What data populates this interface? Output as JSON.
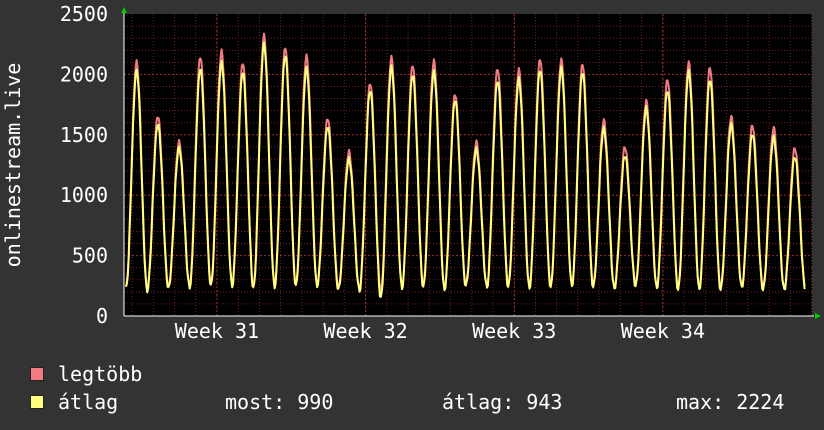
{
  "chart_data": {
    "type": "line",
    "ylabel": "onlinestream.live",
    "ylim": [
      0,
      2500
    ],
    "yticks": [
      "0",
      "500",
      "1000",
      "1500",
      "2000",
      "2500"
    ],
    "x_categories": [
      "Week 31",
      "Week 32",
      "Week 33",
      "Week 34"
    ],
    "grid": true,
    "colors": {
      "background": "#333333",
      "plot": "#000000",
      "grid": "#6e1f1f",
      "axis": "#ffffff",
      "arrow": "#00cc00"
    },
    "series": [
      {
        "name": "legtöbb",
        "color": "#f07c82",
        "daily_peaks": [
          2100,
          1660,
          1440,
          2150,
          2190,
          2100,
          2320,
          2230,
          2150,
          1640,
          1360,
          1930,
          2140,
          2080,
          2110,
          1840,
          1440,
          2050,
          2040,
          2130,
          2120,
          2090,
          1620,
          1400,
          1780,
          1960,
          2100,
          2060,
          1650,
          1580,
          1560,
          1390
        ],
        "daily_troughs": [
          240,
          220,
          240,
          250,
          260,
          260,
          240,
          250,
          260,
          260,
          230,
          220,
          200,
          240,
          250,
          230,
          260,
          250,
          250,
          240,
          250,
          260,
          250,
          240,
          260,
          240,
          230,
          230,
          230,
          250,
          230,
          230
        ]
      },
      {
        "name": "átlag",
        "color": "#ffff80",
        "daily_peaks": [
          2030,
          1590,
          1390,
          2050,
          2100,
          2020,
          2250,
          2160,
          2050,
          1570,
          1300,
          1870,
          2060,
          2000,
          2020,
          1790,
          1380,
          1950,
          1960,
          2040,
          2050,
          2020,
          1550,
          1330,
          1720,
          1870,
          2020,
          1960,
          1580,
          1510,
          1480,
          1320
        ],
        "daily_troughs": [
          230,
          210,
          230,
          240,
          250,
          250,
          230,
          240,
          250,
          250,
          220,
          210,
          150,
          230,
          240,
          220,
          250,
          240,
          240,
          230,
          240,
          250,
          240,
          230,
          250,
          230,
          220,
          220,
          220,
          240,
          220,
          220
        ]
      }
    ]
  },
  "legend": {
    "items": [
      {
        "label": "legtöbb",
        "color": "#f07c82"
      },
      {
        "label": "átlag",
        "color": "#ffff80"
      }
    ],
    "stats": {
      "now": "most: 990",
      "avg": "átlag: 943",
      "max": "max: 2224"
    }
  }
}
